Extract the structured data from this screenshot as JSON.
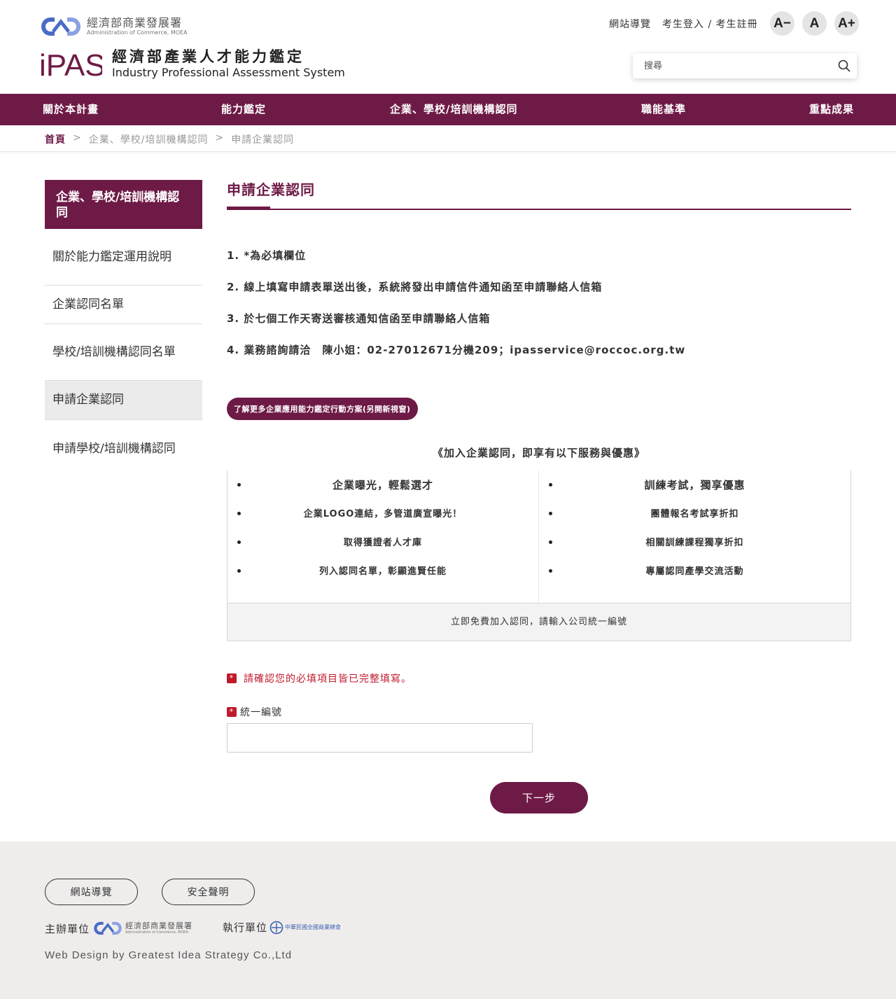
{
  "header": {
    "moea_name_zh": "經濟部商業發展署",
    "moea_name_en": "Administration of Commerce, MOEA",
    "ipas_mark_text": "iPAS",
    "ipas_name_zh": "經濟部產業人才能力鑑定",
    "ipas_name_en": "Industry Professional Assessment System",
    "top_links": [
      "網站導覽",
      "考生登入 / 考生註冊"
    ],
    "font_size_buttons": [
      "A−",
      "A",
      "A+"
    ],
    "search_placeholder": "搜尋"
  },
  "nav": {
    "items": [
      "關於本計畫",
      "能力鑑定",
      "企業、學校/培訓機構認同",
      "職能基準",
      "重點成果"
    ]
  },
  "breadcrumb": {
    "home": "首頁",
    "separator": ">",
    "level1": "企業、學校/培訓機構認同",
    "level2": "申請企業認同"
  },
  "sidebar": {
    "title": "企業、學校/培訓機構認同",
    "items": [
      {
        "label": "關於能力鑑定運用說明"
      },
      {
        "label": "企業認同名單"
      },
      {
        "label": "學校/培訓機構認同名單"
      },
      {
        "label": "申請企業認同"
      },
      {
        "label": "申請學校/培訓機構認同"
      }
    ]
  },
  "main": {
    "title": "申請企業認同",
    "notes": [
      "1. *為必填欄位",
      "2. 線上填寫申請表單送出後，系統將發出申請信件通知函至申請聯絡人信箱",
      "3. 於七個工作天寄送審核通知信函至申請聯絡人信箱",
      "4. 業務諮詢請洽　陳小姐：02-27012671分機209；ipasservice@roccoc.org.tw"
    ],
    "more_button": "了解更多企業應用能力鑑定行動方案(另開新視窗)",
    "benefit_heading": "《加入企業認同，即享有以下服務與優惠》",
    "benefits_left": {
      "head": "企業曝光，輕鬆選才",
      "items": [
        "企業LOGO連結，多管道廣宣曝光！",
        "取得獲證者人才庫",
        "列入認同名單，彰顯進賢任能"
      ]
    },
    "benefits_right": {
      "head": "訓練考試，獨享優惠",
      "items": [
        "團體報名考試享折扣",
        "相關訓練課程獨享折扣",
        "專屬認同產學交流活動"
      ]
    },
    "benefit_footer": "立即免費加入認同，請輸入公司統一編號",
    "required_mark": "*",
    "warning": "請確認您的必填項目皆已完整填寫。",
    "field_label": "統一編號",
    "field_value": "",
    "next_button": "下一步"
  },
  "footer": {
    "buttons": [
      "網站導覽",
      "安全聲明"
    ],
    "organizer_label": "主辦單位",
    "organizer_name_zh": "經濟部商業發展署",
    "organizer_name_en": "Administration of Commerce, MOEA",
    "executor_label": "執行單位",
    "executor_name_zh": "中華民國全國商業總會",
    "credit": "Web Design by  Greatest Idea Strategy Co.,Ltd"
  },
  "colors": {
    "brand": "#6e1a46",
    "warning": "#c01a2b",
    "logo_blue": "#4a6cc7"
  }
}
